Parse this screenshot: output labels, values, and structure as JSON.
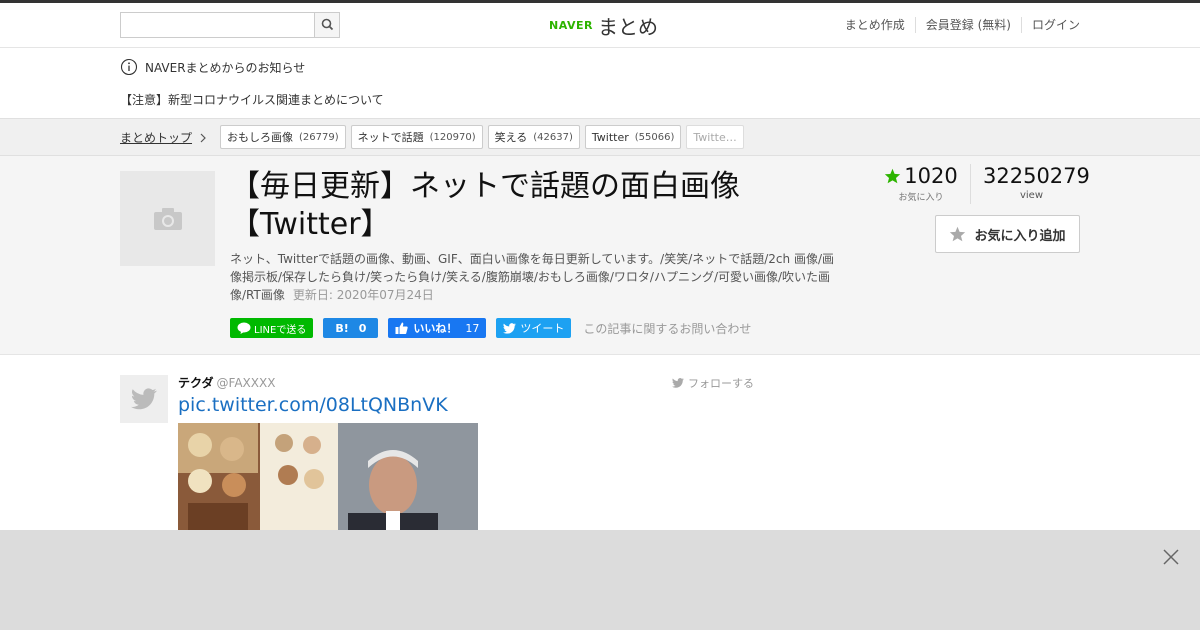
{
  "header": {
    "search_placeholder": "",
    "logo_naver": "NAVER",
    "logo_matome": "まとめ",
    "nav": [
      "まとめ作成",
      "会員登録 (無料)",
      "ログイン"
    ]
  },
  "notice": {
    "title": "NAVERまとめからのお知らせ",
    "link": "【注意】新型コロナウイルス関連まとめについて"
  },
  "breadcrumb": {
    "home": "まとめトップ",
    "tags": [
      {
        "label": "おもしろ画像",
        "count": "(26779)"
      },
      {
        "label": "ネットで話題",
        "count": "(120970)"
      },
      {
        "label": "笑える",
        "count": "(42637)"
      },
      {
        "label": "Twitter",
        "count": "(55066)"
      },
      {
        "label": "Twitte…",
        "count": ""
      }
    ]
  },
  "article": {
    "title": "【毎日更新】ネットで話題の面白画像【Twitter】",
    "description": "ネット、Twitterで話題の画像、動画、GIF、面白い画像を毎日更新しています。/笑笑/ネットで話題/2ch 画像/画像掲示板/保存したら負け/笑ったら負け/笑える/腹筋崩壊/おもしろ画像/ワロタ/ハプニング/可愛い画像/吹いた画像/RT画像",
    "updated": "更新日: 2020年07月24日",
    "favorites": "1020",
    "favorites_label": "お気に入り",
    "views": "32250279",
    "views_label": "view",
    "fav_button": "お気に入り追加",
    "share": {
      "line": "LINEで送る",
      "hatena_count": "0",
      "fb_label": "いいね！",
      "fb_count": "17",
      "tweet": "ツイート",
      "inquiry": "この記事に関するお問い合わせ"
    }
  },
  "tweet": {
    "user_name": "テクダ",
    "user_id": "@FAXXXX",
    "follow": "フォローする",
    "link": "pic.twitter.com/08LtQNBnVK"
  },
  "colors": {
    "accent_green": "#2db400",
    "link_blue": "#1a6fc2",
    "line_green": "#00b900",
    "hatena_blue": "#1e88e5",
    "facebook_blue": "#1877f2",
    "twitter_blue": "#1da1f2"
  }
}
